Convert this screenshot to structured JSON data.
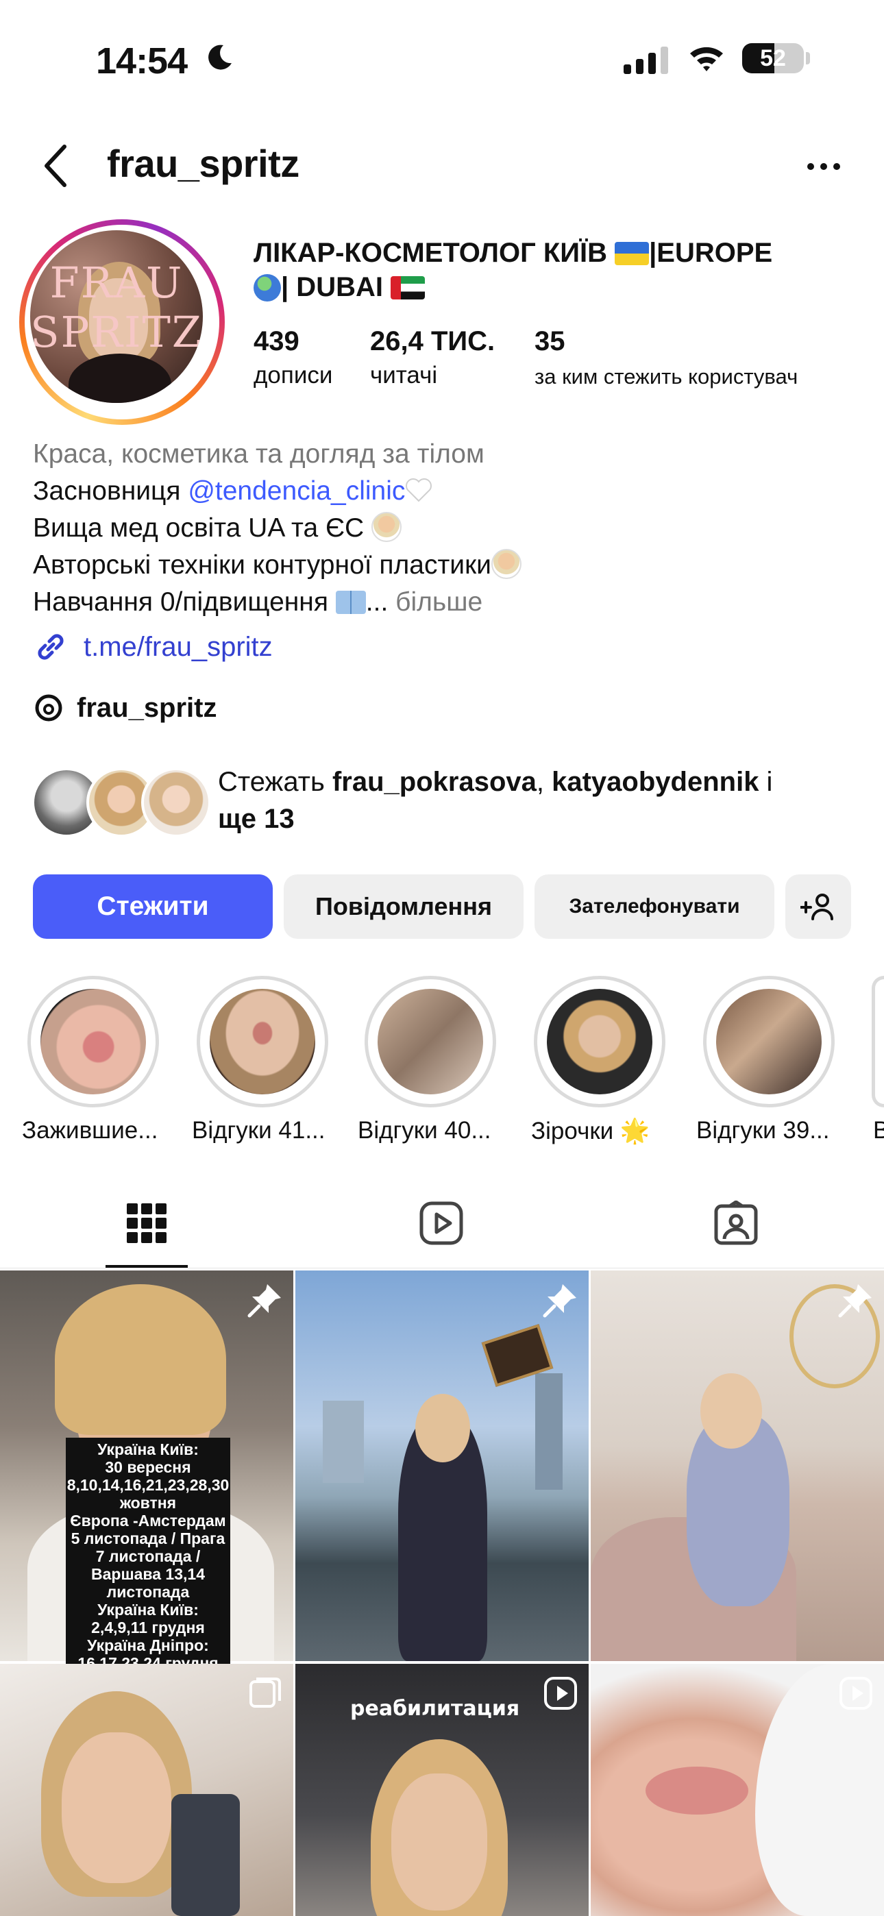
{
  "status_bar": {
    "time": "14:54",
    "battery": "52",
    "battery_level": 0.52
  },
  "header": {
    "username": "frau_spritz"
  },
  "profile": {
    "avatar_text_top": "FRAU",
    "avatar_text_bottom": "SPRITZ",
    "name_line1": "ЛІКАР-КОСМЕТОЛОГ КИЇВ ",
    "name_line1_tail": "|EUROPE",
    "name_line2": "| DUBAI ",
    "stats": [
      {
        "value": "439",
        "label": "дописи"
      },
      {
        "value": "26,4 ТИС.",
        "label": "читачі"
      },
      {
        "value": "35",
        "label": "за ким стежить користувач"
      }
    ]
  },
  "bio": {
    "category": "Краса, косметика та догляд за тілом",
    "line1_prefix": "Засновниця ",
    "line1_mention": "@tendencia_clinic",
    "line2": "Вища мед освіта UA та ЄС ",
    "line3": "Авторські техніки контурної пластики",
    "line4": "Навчання 0/підвищення ",
    "line4_more_prefix": "... ",
    "line4_more": "більше",
    "link": "t.me/frau_spritz",
    "threads": "frau_spritz"
  },
  "followed_by": {
    "prefix": "Стежать ",
    "user1": "frau_pokrasova",
    "sep": ", ",
    "user2": "katyaobydennik",
    "suffix": " і",
    "more": "ще 13"
  },
  "buttons": {
    "follow": "Стежити",
    "message": "Повідомлення",
    "call": "Зателефонувати"
  },
  "highlights": [
    {
      "label": "Зажившие..."
    },
    {
      "label": "Відгуки 41..."
    },
    {
      "label": "Відгуки 40..."
    },
    {
      "label": "Зірочки 🌟"
    },
    {
      "label": "Відгуки 39..."
    },
    {
      "label": "В"
    }
  ],
  "posts": {
    "post1_text": [
      "Україна Київ:",
      "30 вересня",
      "8,10,14,16,21,23,28,30",
      "жовтня",
      "Європа -Амстердам",
      "5 листопада / Прага",
      "7 листопада /",
      "Варшава 13,14",
      "листопада",
      "Україна Київ:",
      "2,4,9,11 грудня",
      "Україна Дніпро:",
      "16,17,23,24 грудня"
    ],
    "post5_text": "реабилитация"
  },
  "colors": {
    "accent": "#4a5df9",
    "link": "#3d5afe"
  },
  "icons": [
    "moon-icon",
    "wifi-icon",
    "back-icon",
    "more-icon",
    "link-icon",
    "threads-icon",
    "add-person-icon",
    "grid-icon",
    "reels-icon",
    "tagged-icon",
    "pin-icon",
    "carousel-icon",
    "video-icon"
  ]
}
